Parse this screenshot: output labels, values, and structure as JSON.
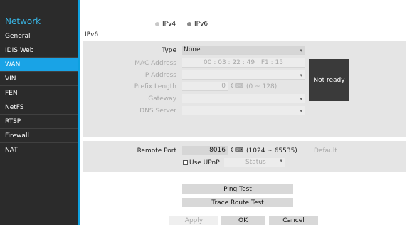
{
  "sidebar": {
    "title": "Network",
    "items": [
      {
        "label": "General"
      },
      {
        "label": "IDIS Web"
      },
      {
        "label": "WAN"
      },
      {
        "label": "VIN"
      },
      {
        "label": "FEN"
      },
      {
        "label": "NetFS"
      },
      {
        "label": "RTSP"
      },
      {
        "label": "Firewall"
      },
      {
        "label": "NAT"
      }
    ],
    "active": "WAN",
    "accent_color": "#19a3e6"
  },
  "ip_mode": {
    "options": [
      "IPv4",
      "IPv6"
    ],
    "selected": "IPv6"
  },
  "section_title": "IPv6",
  "ipv6": {
    "type_label": "Type",
    "type_value": "None",
    "mac_label": "MAC Address",
    "mac_value": "00 : 03 : 22 : 49 : F1 : 15",
    "ip_label": "IP Address",
    "ip_value": "",
    "prefix_label": "Prefix Length",
    "prefix_value": "0",
    "prefix_range": "(0 ~ 128)",
    "gateway_label": "Gateway",
    "gateway_value": "",
    "dns_label": "DNS Server",
    "dns_value": "",
    "status": "Not ready"
  },
  "remote": {
    "port_label": "Remote Port",
    "port_value": "8016",
    "port_range": "(1024 ~ 65535)",
    "default_label": "Default",
    "upnp_label": "Use UPnP",
    "upnp_checked": false,
    "status_label": "Status"
  },
  "tests": {
    "ping_label": "Ping Test",
    "trace_label": "Trace Route Test"
  },
  "footer": {
    "apply_label": "Apply",
    "ok_label": "OK",
    "cancel_label": "Cancel"
  },
  "icons": {
    "spinner": "spinner-arrows-icon",
    "keyboard": "keyboard-icon",
    "dropdown": "caret-down-icon"
  }
}
